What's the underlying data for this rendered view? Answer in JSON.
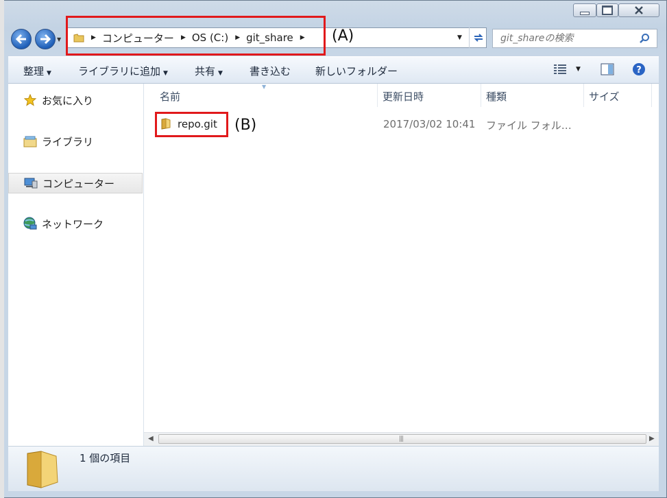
{
  "window": {
    "minimize_icon": "minimize-icon",
    "maximize_icon": "maximize-icon",
    "close_icon": "close-icon"
  },
  "address_bar": {
    "crumbs": [
      "コンピューター",
      "OS (C:)",
      "git_share"
    ],
    "search_placeholder": "git_shareの検索"
  },
  "toolbar": {
    "organize": "整理",
    "add_to_library": "ライブラリに追加",
    "share": "共有",
    "burn": "書き込む",
    "new_folder": "新しいフォルダー"
  },
  "navigation": {
    "items": [
      {
        "label": "お気に入り",
        "icon": "star-icon"
      },
      {
        "label": "ライブラリ",
        "icon": "library-icon"
      },
      {
        "label": "コンピューター",
        "icon": "computer-icon"
      },
      {
        "label": "ネットワーク",
        "icon": "network-icon"
      }
    ]
  },
  "file_list": {
    "columns": [
      "名前",
      "更新日時",
      "種類",
      "サイズ"
    ],
    "rows": [
      {
        "name": "repo.git",
        "modified": "2017/03/02 10:41",
        "type": "ファイル フォル…",
        "size": ""
      }
    ]
  },
  "status_bar": {
    "item_count": "1 個の項目"
  },
  "annotations": {
    "a": "(A)",
    "b": "(B)",
    "box_color": "#e1191b"
  }
}
